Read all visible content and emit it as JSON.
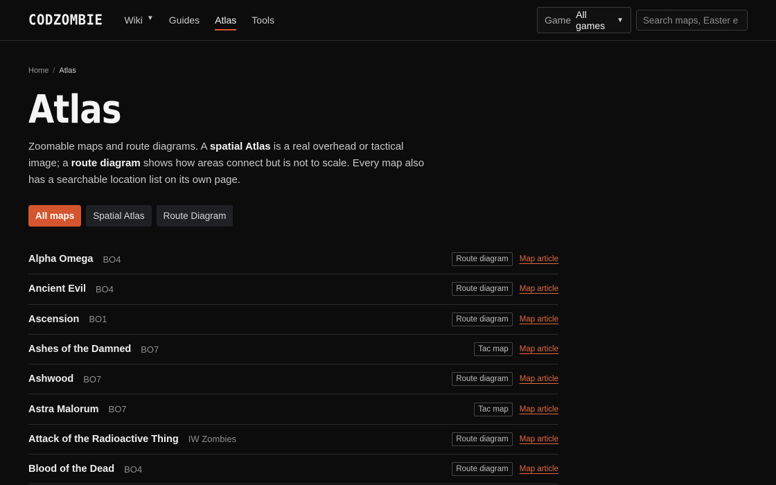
{
  "header": {
    "logo": "CODZOMBIE",
    "nav": [
      {
        "label": "Wiki",
        "has_dropdown": true,
        "active": false
      },
      {
        "label": "Guides",
        "has_dropdown": false,
        "active": false
      },
      {
        "label": "Atlas",
        "has_dropdown": false,
        "active": true
      },
      {
        "label": "Tools",
        "has_dropdown": false,
        "active": false
      }
    ],
    "game_select": {
      "label": "Game",
      "value": "All games"
    },
    "search": {
      "placeholder": "Search maps, Easter e"
    }
  },
  "breadcrumb": {
    "home": "Home",
    "separator": "/",
    "current": "Atlas"
  },
  "page": {
    "title": "Atlas",
    "intro": [
      {
        "text": "Zoomable maps and route diagrams. A ",
        "bold": false
      },
      {
        "text": "spatial Atlas",
        "bold": true
      },
      {
        "text": " is a real overhead or tactical image; a ",
        "bold": false
      },
      {
        "text": "route diagram",
        "bold": true
      },
      {
        "text": " shows how areas connect but is not to scale. Every map also has a searchable location list on its own page.",
        "bold": false
      }
    ]
  },
  "filters": [
    {
      "label": "All maps",
      "active": true
    },
    {
      "label": "Spatial Atlas",
      "active": false
    },
    {
      "label": "Route Diagram",
      "active": false
    }
  ],
  "maps": [
    {
      "name": "Alpha Omega",
      "game": "BO4",
      "tag": "Route diagram",
      "link": "Map article"
    },
    {
      "name": "Ancient Evil",
      "game": "BO4",
      "tag": "Route diagram",
      "link": "Map article"
    },
    {
      "name": "Ascension",
      "game": "BO1",
      "tag": "Route diagram",
      "link": "Map article"
    },
    {
      "name": "Ashes of the Damned",
      "game": "BO7",
      "tag": "Tac map",
      "link": "Map article"
    },
    {
      "name": "Ashwood",
      "game": "BO7",
      "tag": "Route diagram",
      "link": "Map article"
    },
    {
      "name": "Astra Malorum",
      "game": "BO7",
      "tag": "Tac map",
      "link": "Map article"
    },
    {
      "name": "Attack of the Radioactive Thing",
      "game": "IW Zombies",
      "tag": "Route diagram",
      "link": "Map article"
    },
    {
      "name": "Blood of the Dead",
      "game": "BO4",
      "tag": "Route diagram",
      "link": "Map article"
    }
  ],
  "colors": {
    "accent": "#d4552e",
    "background": "#0c0c0c"
  }
}
